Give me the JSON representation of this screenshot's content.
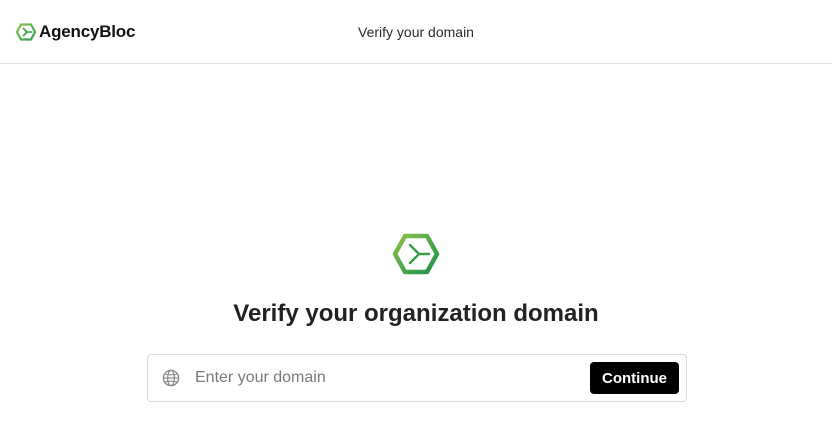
{
  "brand": {
    "name": "AgencyBloc",
    "logo_icon": "hexagon-chevron-icon",
    "accent_color": "#4caf50",
    "accent_dark": "#2e7d32"
  },
  "header": {
    "title": "Verify your domain"
  },
  "main": {
    "icon": "hexagon-chevron-icon",
    "title": "Verify your organization domain",
    "form": {
      "input_icon": "globe-icon",
      "input_value": "",
      "input_placeholder": "Enter your domain",
      "button_label": "Continue",
      "button_color": "#000000"
    }
  }
}
